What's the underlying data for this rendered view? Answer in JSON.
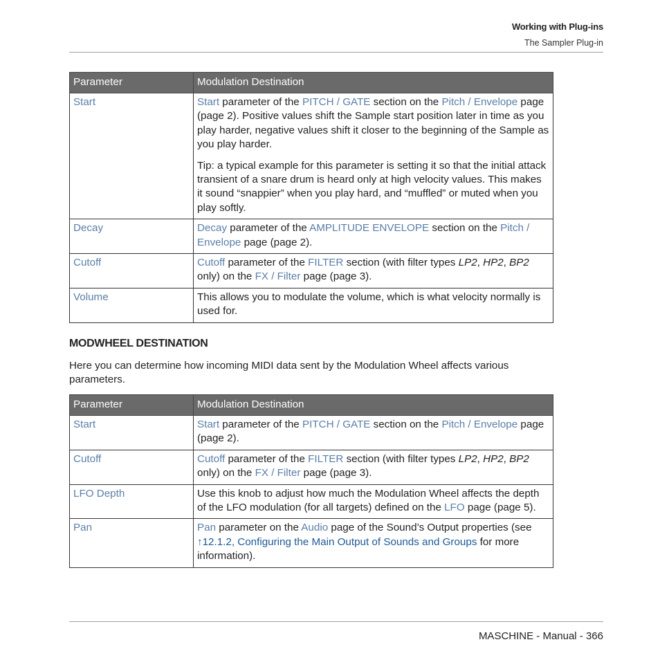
{
  "header": {
    "chapter": "Working with Plug-ins",
    "section": "The Sampler Plug-in"
  },
  "table1": {
    "headers": [
      "Parameter",
      "Modulation Destination"
    ],
    "rows": [
      {
        "param": "Start",
        "desc": [
          [
            {
              "t": "Start",
              "c": "link"
            },
            {
              "t": " parameter of the "
            },
            {
              "t": "PITCH / GATE",
              "c": "link"
            },
            {
              "t": " section on the "
            },
            {
              "t": "Pitch / Envelope",
              "c": "link"
            },
            {
              "t": " page (page 2). Positive values shift the Sample start position later in time as you play harder, negative values shift it closer to the beginning of the Sample as you play harder."
            }
          ],
          [
            {
              "t": "Tip: a typical example for this parameter is setting it so that the initial attack transient of a snare drum is heard only at high velocity values. This makes it sound “snappier” when you play hard, and “muffled” or muted when you play softly."
            }
          ]
        ]
      },
      {
        "param": "Decay",
        "desc": [
          [
            {
              "t": "Decay",
              "c": "link"
            },
            {
              "t": " parameter of the "
            },
            {
              "t": "AMPLITUDE ENVELOPE",
              "c": "link"
            },
            {
              "t": " section on the "
            },
            {
              "t": "Pitch / Envelope",
              "c": "link"
            },
            {
              "t": " page (page 2)."
            }
          ]
        ]
      },
      {
        "param": "Cutoff",
        "desc": [
          [
            {
              "t": "Cutoff",
              "c": "link"
            },
            {
              "t": " parameter of the "
            },
            {
              "t": "FILTER",
              "c": "link"
            },
            {
              "t": " section (with filter types "
            },
            {
              "t": "LP2",
              "c": "it"
            },
            {
              "t": ", "
            },
            {
              "t": "HP2",
              "c": "it"
            },
            {
              "t": ", "
            },
            {
              "t": "BP2",
              "c": "it"
            },
            {
              "t": " only) on the "
            },
            {
              "t": "FX / Filter",
              "c": "link"
            },
            {
              "t": " page (page 3)."
            }
          ]
        ]
      },
      {
        "param": "Volume",
        "desc": [
          [
            {
              "t": "This allows you to modulate the volume, which is what velocity normally is used for."
            }
          ]
        ]
      }
    ]
  },
  "modwheel": {
    "heading": "MODWHEEL DESTINATION",
    "intro": "Here you can determine how incoming MIDI data sent by the Modulation Wheel affects various parameters."
  },
  "table2": {
    "headers": [
      "Parameter",
      "Modulation Destination"
    ],
    "rows": [
      {
        "param": "Start",
        "desc": [
          [
            {
              "t": "Start",
              "c": "link"
            },
            {
              "t": " parameter of the "
            },
            {
              "t": "PITCH / GATE",
              "c": "link"
            },
            {
              "t": " section on the "
            },
            {
              "t": "Pitch / Envelope",
              "c": "link"
            },
            {
              "t": " page (page 2)."
            }
          ]
        ]
      },
      {
        "param": "Cutoff",
        "desc": [
          [
            {
              "t": "Cutoff",
              "c": "link"
            },
            {
              "t": " parameter of the "
            },
            {
              "t": "FILTER",
              "c": "link"
            },
            {
              "t": " section (with filter types "
            },
            {
              "t": "LP2",
              "c": "it"
            },
            {
              "t": ", "
            },
            {
              "t": "HP2",
              "c": "it"
            },
            {
              "t": ", "
            },
            {
              "t": "BP2",
              "c": "it"
            },
            {
              "t": " only) on the "
            },
            {
              "t": "FX / Filter",
              "c": "link"
            },
            {
              "t": " page (page 3)."
            }
          ]
        ]
      },
      {
        "param": "LFO Depth",
        "desc": [
          [
            {
              "t": "Use this knob to adjust how much the Modulation Wheel affects the depth of the LFO modulation (for all targets) defined on the "
            },
            {
              "t": "LFO",
              "c": "link"
            },
            {
              "t": " page (page 5)."
            }
          ]
        ]
      },
      {
        "param": "Pan",
        "desc": [
          [
            {
              "t": "Pan",
              "c": "link"
            },
            {
              "t": " parameter on the "
            },
            {
              "t": "Audio",
              "c": "link"
            },
            {
              "t": " page of the Sound’s Output properties (see "
            },
            {
              "t": "↑12.1.2, Configuring the Main Output of Sounds and Groups",
              "c": "xref"
            },
            {
              "t": " for more information)."
            }
          ]
        ]
      }
    ]
  },
  "footer": {
    "text": "MASCHINE - Manual - 366"
  },
  "colors": {
    "link": "#5a7ea8",
    "xref": "#1e5a96",
    "table_header_bg": "#6a6a6a"
  }
}
